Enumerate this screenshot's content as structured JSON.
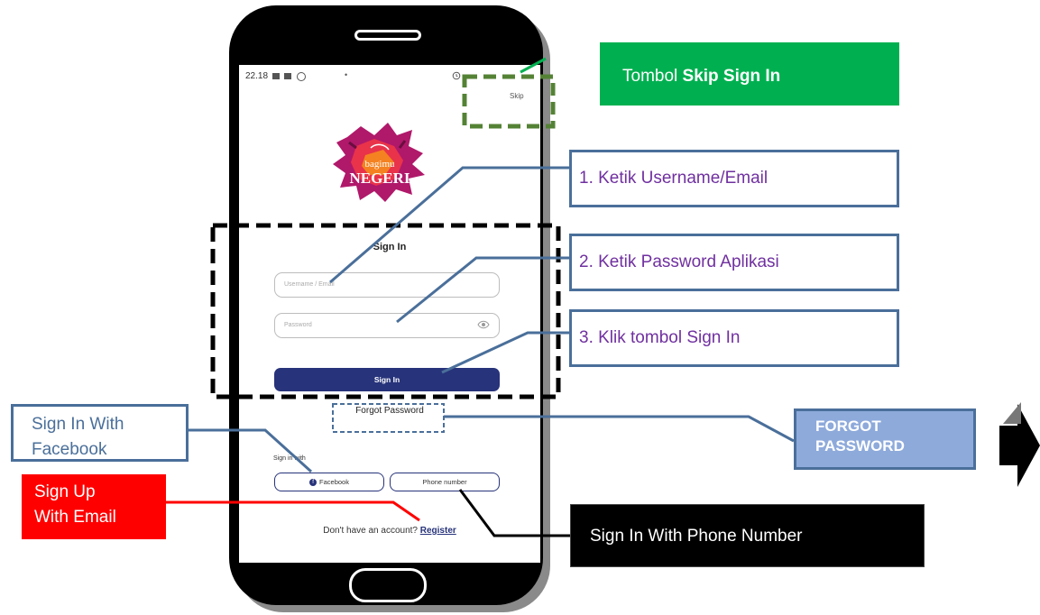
{
  "phone": {
    "status_time": "22.18",
    "status_dot": "•",
    "skip_label": "Skip",
    "logo_text_top": "bagimu",
    "logo_text_bottom": "NEGERI",
    "signin_title": "Sign In",
    "username_placeholder": "Username / Email",
    "password_placeholder": "Password",
    "signin_button": "Sign In",
    "forgot_password": "Forgot Password",
    "signin_with": "Sign in with",
    "facebook_button": "Facebook",
    "facebook_icon_glyph": "f",
    "phone_button": "Phone number",
    "no_account_text": "Don't have an account?",
    "register_link": "Register"
  },
  "callouts": {
    "skip_prefix": "Tombol ",
    "skip_bold": "Skip Sign In",
    "step1": "1. Ketik Username/Email",
    "step2": "2. Ketik Password Aplikasi",
    "step3": "3. Klik tombol Sign In",
    "signin_facebook_line1": "Sign In With",
    "signin_facebook_line2": "Facebook",
    "signup_line1": "Sign Up",
    "signup_line2": "With Email",
    "signin_phone": "Sign In With Phone Number",
    "forgot_line1": "FORGOT",
    "forgot_line2": "PASSWORD"
  },
  "colors": {
    "accent_navy": "#27337a",
    "callout_green": "#00b050",
    "callout_blue_border": "#4a6f9a",
    "callout_purple_text": "#7030a0",
    "callout_red": "#ff0000",
    "callout_forgot_fill": "#8eaadb",
    "skip_dash_green": "#548235"
  },
  "icons": [
    "eye-icon",
    "facebook-icon",
    "next-arrow-icon",
    "gallery-icon",
    "alarm-icon"
  ]
}
